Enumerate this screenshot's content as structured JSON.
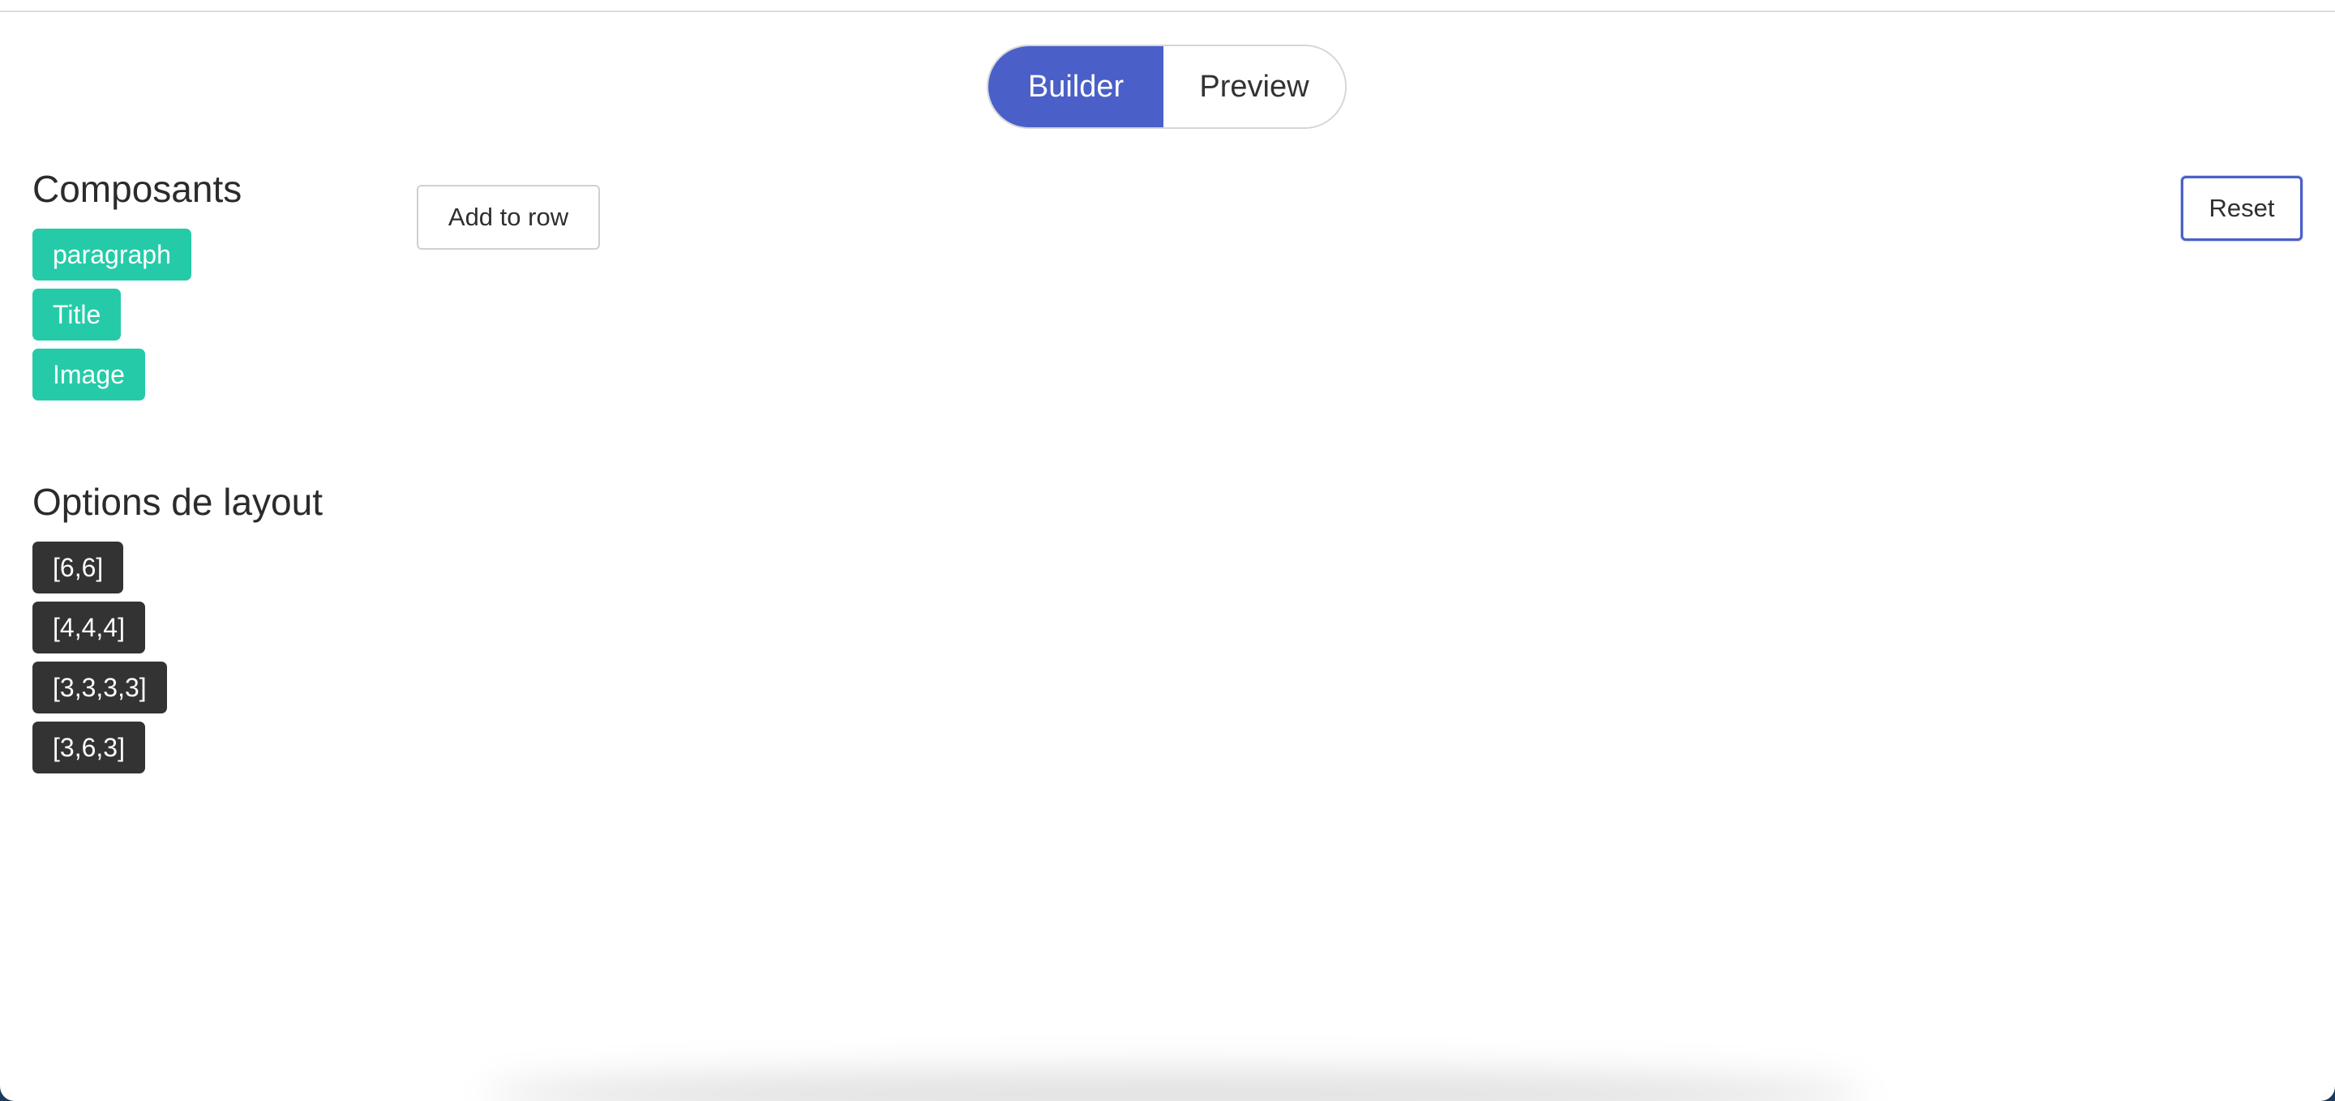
{
  "mode_toggle": {
    "builder_label": "Builder",
    "preview_label": "Preview",
    "active": "Builder",
    "active_color": "#4a60c8"
  },
  "components": {
    "title": "Composants",
    "items": [
      "paragraph",
      "Title",
      "Image"
    ],
    "color": "#25cba8"
  },
  "layout_options": {
    "title": "Options de layout",
    "items": [
      "[6,6]",
      "[4,4,4]",
      "[3,3,3,3]",
      "[3,6,3]"
    ],
    "color": "#333333"
  },
  "toolbar": {
    "add_row_label": "Add to row",
    "reset_label": "Reset"
  }
}
